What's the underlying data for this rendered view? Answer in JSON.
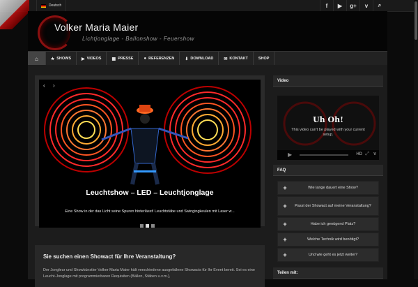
{
  "topbar": {
    "language": "Deutsch",
    "social_icons": [
      "facebook-icon",
      "youtube-icon",
      "google-plus-icon",
      "vimeo-icon",
      "search-icon"
    ],
    "social_glyphs": [
      "f",
      "▶",
      "g+",
      "v",
      "⌕"
    ]
  },
  "header": {
    "title": "Volker Maria Maier",
    "subtitle": "Lichtjonglage - Ballonshow - Feuershow"
  },
  "nav": {
    "items": [
      {
        "label": "SHOWS",
        "icon": "★"
      },
      {
        "label": "VIDEOS",
        "icon": "▶"
      },
      {
        "label": "PRESSE",
        "icon": "▦"
      },
      {
        "label": "REFERENZEN",
        "icon": "●"
      },
      {
        "label": "DOWNLOAD",
        "icon": "⬇"
      },
      {
        "label": "KONTAKT",
        "icon": "✉"
      },
      {
        "label": "SHOP",
        "icon": ""
      }
    ]
  },
  "slider": {
    "title": "Leuchtshow – LED – Leuchtjonglage",
    "text": "Eine Show in der das Licht seine Spuren hinterlässt! Leuchtstäbe und Swingingkeulen mit Laser w...",
    "prev": "‹",
    "next": "›"
  },
  "main": {
    "title": "Sie suchen einen Showact für Ihre Veranstaltung?",
    "text": "Der Jongleur und Showkünstler Volker Maria Maier hält verschiedene ausgefallene Showacts für Ihr Event bereit. Sei es eine Leucht-Jonglage mit programmierbaren Requisiten (Bällen, Stäben u.v.m.),"
  },
  "video": {
    "heading": "Video",
    "title": "Uh Oh!",
    "message": "This video can't be played with your current setup."
  },
  "faq": {
    "heading": "FAQ",
    "items": [
      "Wie lange dauert eine Show?",
      "Passt der Showact auf meine Veranstaltung?",
      "Habe ich genügend Platz?",
      "Welche Technik wird benötigt?",
      "Und wie geht es jetzt weiter?"
    ]
  },
  "share": {
    "heading": "Teilen mit:"
  },
  "colors": {
    "accent": "#8a1010",
    "background": "#0b0b0b"
  }
}
